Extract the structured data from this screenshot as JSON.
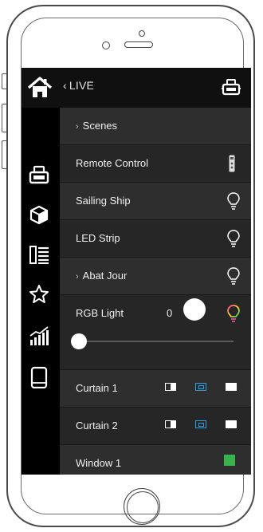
{
  "header": {
    "back_label": "LIVE",
    "back_icon": "chevron-left-icon",
    "home_icon": "home-icon",
    "robot_icon": "robot-icon"
  },
  "sidebar": {
    "items": [
      {
        "icon": "robot-icon"
      },
      {
        "icon": "cube-icon"
      },
      {
        "icon": "list-panel-icon"
      },
      {
        "icon": "star-icon"
      },
      {
        "icon": "stats-icon"
      },
      {
        "icon": "tablet-icon"
      }
    ]
  },
  "devices": {
    "scenes": {
      "label": "Scenes"
    },
    "remote_control": {
      "label": "Remote Control",
      "icon": "remote-icon"
    },
    "sailing_ship": {
      "label": "Sailing Ship",
      "icon": "bulb-icon"
    },
    "led_strip": {
      "label": "LED Strip",
      "icon": "bulb-icon"
    },
    "abat_jour": {
      "label": "Abat Jour",
      "icon": "bulb-icon"
    },
    "rgb_light": {
      "label": "RGB Light",
      "value": "0",
      "slider_level": 0,
      "icon": "rgb-bulb-icon"
    },
    "curtain_1": {
      "label": "Curtain 1"
    },
    "curtain_2": {
      "label": "Curtain 2"
    },
    "window_1": {
      "label": "Window 1",
      "status_color": "#37b24d"
    }
  },
  "colors": {
    "screen_bg": "#000000",
    "row_bg": "#262626",
    "accent_blue": "#2aa0e0",
    "status_green": "#37b24d"
  }
}
